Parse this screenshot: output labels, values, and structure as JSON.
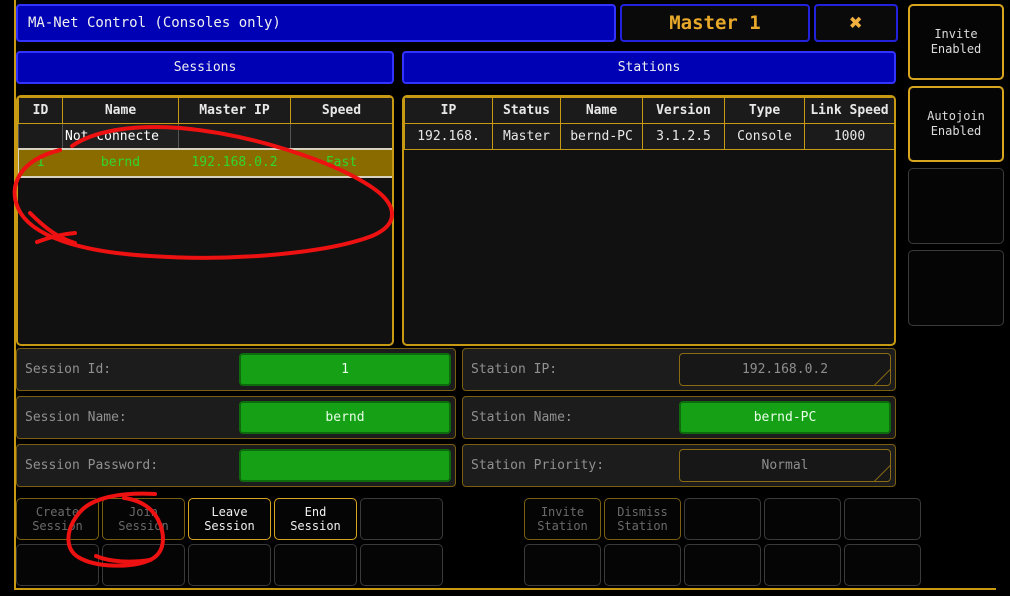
{
  "window": {
    "title": "MA-Net Control (Consoles only)",
    "master_label": "Master 1",
    "close_icon": "close-icon",
    "close_glyph": "✖"
  },
  "colors": {
    "frame": "#c89a14",
    "title_bg": "#0000b4",
    "accent_gold": "#e8a82a",
    "green_field": "#15a015",
    "selected_row_bg": "#8a6b00",
    "selected_row_text": "#2fd62f",
    "annotation_red": "#ee1111"
  },
  "sessions": {
    "header": "Sessions",
    "columns": [
      "ID",
      "Name",
      "Master IP",
      "Speed"
    ],
    "rows": [
      {
        "selected": false,
        "id": "",
        "name": "Not connecte",
        "master_ip": "",
        "speed": ""
      },
      {
        "selected": true,
        "id": "1",
        "name": "bernd",
        "master_ip": "192.168.0.2",
        "speed": "Fast"
      }
    ]
  },
  "stations": {
    "header": "Stations",
    "columns": [
      "IP",
      "Status",
      "Name",
      "Version",
      "Type",
      "Link Speed"
    ],
    "rows": [
      {
        "ip": "192.168.",
        "status": "Master",
        "name": "bernd-PC",
        "version": "3.1.2.5",
        "type": "Console",
        "link_speed": "1000"
      }
    ]
  },
  "session_form": [
    {
      "label": "Session Id:",
      "value": "1",
      "style": "green"
    },
    {
      "label": "Session Name:",
      "value": "bernd",
      "style": "green"
    },
    {
      "label": "Session Password:",
      "value": "",
      "style": "green"
    }
  ],
  "station_form": [
    {
      "label": "Station IP:",
      "value": "192.168.0.2",
      "style": "dark"
    },
    {
      "label": "Station Name:",
      "value": "bernd-PC",
      "style": "green"
    },
    {
      "label": "Station Priority:",
      "value": "Normal",
      "style": "dark"
    }
  ],
  "left_buttons_row1": [
    {
      "line1": "Create",
      "line2": "Session",
      "state": "dimmed"
    },
    {
      "line1": "Join",
      "line2": "Session",
      "state": "dimmed"
    },
    {
      "line1": "Leave",
      "line2": "Session",
      "state": "active"
    },
    {
      "line1": "End",
      "line2": "Session",
      "state": "active"
    },
    {
      "line1": "",
      "line2": "",
      "state": "empty"
    }
  ],
  "left_buttons_row2": [
    {
      "line1": "",
      "line2": "",
      "state": "empty"
    },
    {
      "line1": "",
      "line2": "",
      "state": "empty"
    },
    {
      "line1": "",
      "line2": "",
      "state": "empty"
    },
    {
      "line1": "",
      "line2": "",
      "state": "empty"
    },
    {
      "line1": "",
      "line2": "",
      "state": "empty"
    }
  ],
  "right_buttons_row1": [
    {
      "line1": "Invite",
      "line2": "Station",
      "state": "dimmed"
    },
    {
      "line1": "Dismiss",
      "line2": "Station",
      "state": "dimmed"
    },
    {
      "line1": "",
      "line2": "",
      "state": "empty"
    },
    {
      "line1": "",
      "line2": "",
      "state": "empty"
    },
    {
      "line1": "",
      "line2": "",
      "state": "empty"
    }
  ],
  "right_buttons_row2": [
    {
      "line1": "",
      "line2": "",
      "state": "empty"
    },
    {
      "line1": "",
      "line2": "",
      "state": "empty"
    },
    {
      "line1": "",
      "line2": "",
      "state": "empty"
    },
    {
      "line1": "",
      "line2": "",
      "state": "empty"
    },
    {
      "line1": "",
      "line2": "",
      "state": "empty"
    }
  ],
  "sidebar": [
    {
      "line1": "Invite",
      "line2": "Enabled",
      "state": "on"
    },
    {
      "line1": "Autojoin",
      "line2": "Enabled",
      "state": "on"
    },
    {
      "line1": "",
      "line2": "",
      "state": "off"
    },
    {
      "line1": "",
      "line2": "",
      "state": "off"
    }
  ],
  "annotations": {
    "ellipse_session_row": "hand-drawn red ellipse around selected session row",
    "ellipse_create_join": "hand-drawn red loop around Create Session and Join Session buttons"
  }
}
